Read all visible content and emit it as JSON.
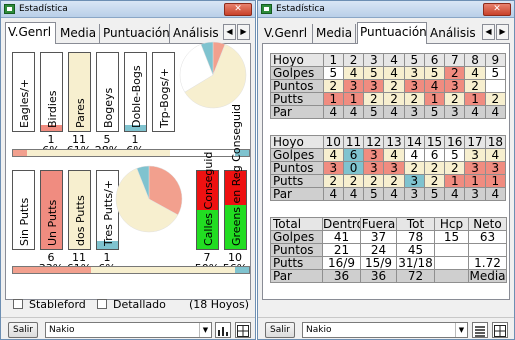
{
  "windows": [
    {
      "title": "Estadística",
      "close_label": "✕",
      "tabs": [
        "V.Genrl",
        "Media",
        "Puntuación",
        "Análisis"
      ],
      "selected_tab": "V.Genrl",
      "scroll_left": "◀",
      "scroll_right": "▶",
      "top_bars": [
        {
          "label": "Eagles/+",
          "count": "",
          "pct": "",
          "fill": 0,
          "color": "#d9d9d9"
        },
        {
          "label": "Birdies",
          "count": "1",
          "pct": "6%",
          "fill": 0.08,
          "color": "#f08c80"
        },
        {
          "label": "Pares",
          "count": "11",
          "pct": "61%",
          "fill": 1.0,
          "color": "#f7efcf"
        },
        {
          "label": "Bogeys",
          "count": "5",
          "pct": "28%",
          "fill": 0.0,
          "color": "#ffffff"
        },
        {
          "label": "Doble-Bogs",
          "count": "1",
          "pct": "6%",
          "fill": 0.08,
          "color": "#7fc3cf"
        },
        {
          "label": "Trp-Bogs/+",
          "count": "",
          "pct": "",
          "fill": 0,
          "color": "#ffffff"
        }
      ],
      "top_pie": [
        {
          "value": 6,
          "color": "#f2a08e"
        },
        {
          "value": 61,
          "color": "#f7efcf"
        },
        {
          "value": 28,
          "color": "#ffffff"
        },
        {
          "value": 6,
          "color": "#7fc3cf"
        }
      ],
      "top_strip": [
        {
          "value": 6,
          "color": "#f2a08e"
        },
        {
          "value": 61,
          "color": "#f7efcf"
        },
        {
          "value": 28,
          "color": "#ffffff"
        },
        {
          "value": 6,
          "color": "#7fc3cf"
        }
      ],
      "bottom_bars": [
        {
          "label": "Sin Putts",
          "count": "",
          "pct": "",
          "fill": 0,
          "color": "#ffffff"
        },
        {
          "label": "Un Putts",
          "count": "6",
          "pct": "33%",
          "fill": 1.0,
          "color": "#f08c80"
        },
        {
          "label": "dos Putts",
          "count": "11",
          "pct": "61%",
          "fill": 1.0,
          "color": "#f7efcf"
        },
        {
          "label": "Tres Putts/+",
          "count": "1",
          "pct": "6%",
          "fill": 0.1,
          "color": "#7fc3cf"
        }
      ],
      "bottom_pie": [
        {
          "value": 33,
          "color": "#f2a08e"
        },
        {
          "value": 61,
          "color": "#f7efcf"
        },
        {
          "value": 6,
          "color": "#7fc3cf"
        }
      ],
      "green_bars": [
        {
          "label": "Calles Conseguid",
          "count": "7",
          "pct": "50%",
          "fill": 0.5
        },
        {
          "label": "Greens en Reg Conseguid",
          "count": "10",
          "pct": "56%",
          "fill": 0.56
        }
      ],
      "bottom_strip": [
        {
          "value": 33,
          "color": "#f2a08e"
        },
        {
          "value": 61,
          "color": "#f7efcf"
        },
        {
          "value": 6,
          "color": "#7fc3cf"
        }
      ],
      "check_stableford": "Stableford",
      "check_detallado": "Detallado",
      "holes_note": "(18 Hoyos)",
      "salir": "Salir",
      "player": "Nakio",
      "combo_arrow": "▼"
    },
    {
      "title": "Estadística",
      "close_label": "✕",
      "tabs": [
        "V.Genrl",
        "Media",
        "Puntuación",
        "Análisis"
      ],
      "selected_tab": "Puntuación",
      "scroll_left": "◀",
      "scroll_right": "▶",
      "front_nine": {
        "holes": [
          "Hoyo",
          "1",
          "2",
          "3",
          "4",
          "5",
          "6",
          "7",
          "8",
          "9"
        ],
        "golpes": [
          "Golpes",
          "5",
          "4",
          "5",
          "4",
          "3",
          "5",
          "2",
          "4",
          "5"
        ],
        "puntos": [
          "Puntos",
          "2",
          "3",
          "3",
          "2",
          "3",
          "4",
          "3",
          "2",
          ""
        ],
        "putts": [
          "Putts",
          "1",
          "1",
          "2",
          "2",
          "2",
          "1",
          "2",
          "1",
          "2"
        ],
        "par": [
          "Par",
          "4",
          "4",
          "5",
          "4",
          "3",
          "5",
          "3",
          "4",
          "4"
        ]
      },
      "back_nine": {
        "holes": [
          "Hoyo",
          "10",
          "11",
          "12",
          "13",
          "14",
          "15",
          "16",
          "17",
          "18"
        ],
        "golpes": [
          "Golpes",
          "4",
          "6",
          "3",
          "4",
          "4",
          "6",
          "5",
          "3",
          "4"
        ],
        "puntos": [
          "Puntos",
          "3",
          "0",
          "3",
          "3",
          "2",
          "2",
          "2",
          "3",
          "3"
        ],
        "putts": [
          "Putts",
          "2",
          "2",
          "2",
          "2",
          "3",
          "2",
          "1",
          "1",
          "1"
        ],
        "par": [
          "Par",
          "4",
          "4",
          "5",
          "4",
          "3",
          "5",
          "4",
          "3",
          "4"
        ]
      },
      "totals": {
        "header": [
          "Total",
          "Dentro",
          "Fuera",
          "Tot",
          "Hcp",
          "Neto"
        ],
        "golpes": [
          "Golpes",
          "41",
          "37",
          "78",
          "15",
          "63"
        ],
        "puntos": [
          "Puntos",
          "21",
          "24",
          "45",
          "",
          ""
        ],
        "putts": [
          "Putts",
          "16/9",
          "15/9",
          "31/18",
          "",
          "1.72"
        ],
        "par": [
          "Par",
          "36",
          "36",
          "72",
          "",
          "Media"
        ]
      },
      "salir": "Salir",
      "player": "Nakio",
      "combo_arrow": "▼"
    }
  ],
  "colors": {
    "red": "#f08c80",
    "cream": "#f7efcf",
    "blue": "#7fc3cf",
    "green": "#22dd22",
    "bar_red": "#ee1111"
  }
}
